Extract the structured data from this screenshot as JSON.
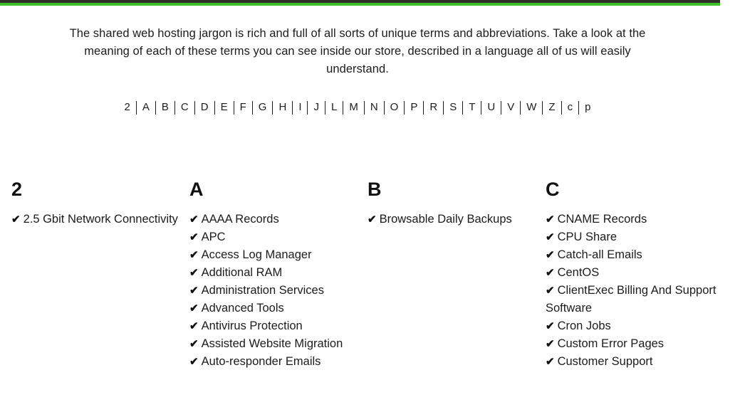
{
  "topbar": {
    "bg_color": "#2f2f2f",
    "accent_color": "#3fbf2a"
  },
  "intro": {
    "text": "The shared web hosting jargon is rich and full of all sorts of unique terms and abbreviations. Take a look at the meaning of each of these terms you can see inside our store, described in a language all of us will easily understand."
  },
  "alpha_nav": {
    "separator": "|",
    "letters": [
      "2",
      "A",
      "B",
      "C",
      "D",
      "E",
      "F",
      "G",
      "H",
      "I",
      "J",
      "L",
      "M",
      "N",
      "O",
      "P",
      "R",
      "S",
      "T",
      "U",
      "V",
      "W",
      "Z",
      "c",
      "p"
    ]
  },
  "columns": [
    {
      "heading": "2",
      "items": [
        {
          "tick": "✔",
          "label": "2.5 Gbit Network Connectivity"
        }
      ]
    },
    {
      "heading": "A",
      "items": [
        {
          "tick": "✔",
          "label": "AAAA Records"
        },
        {
          "tick": "✔",
          "label": "APC"
        },
        {
          "tick": "✔",
          "label": "Access Log Manager"
        },
        {
          "tick": "✔",
          "label": "Additional RAM"
        },
        {
          "tick": "✔",
          "label": "Administration Services"
        },
        {
          "tick": "✔",
          "label": "Advanced Tools"
        },
        {
          "tick": "✔",
          "label": "Antivirus Protection"
        },
        {
          "tick": "✔",
          "label": "Assisted Website Migration"
        },
        {
          "tick": "✔",
          "label": "Auto-responder Emails"
        }
      ]
    },
    {
      "heading": "B",
      "items": [
        {
          "tick": "✔",
          "label": "Browsable Daily Backups"
        }
      ]
    },
    {
      "heading": "C",
      "items": [
        {
          "tick": "✔",
          "label": "CNAME Records"
        },
        {
          "tick": "✔",
          "label": "CPU Share"
        },
        {
          "tick": "✔",
          "label": "Catch-all Emails"
        },
        {
          "tick": "✔",
          "label": "CentOS"
        },
        {
          "tick": "✔",
          "label": "ClientExec Billing And Support Software"
        },
        {
          "tick": "✔",
          "label": "Cron Jobs"
        },
        {
          "tick": "✔",
          "label": "Custom Error Pages"
        },
        {
          "tick": "✔",
          "label": "Customer Support"
        }
      ]
    }
  ]
}
